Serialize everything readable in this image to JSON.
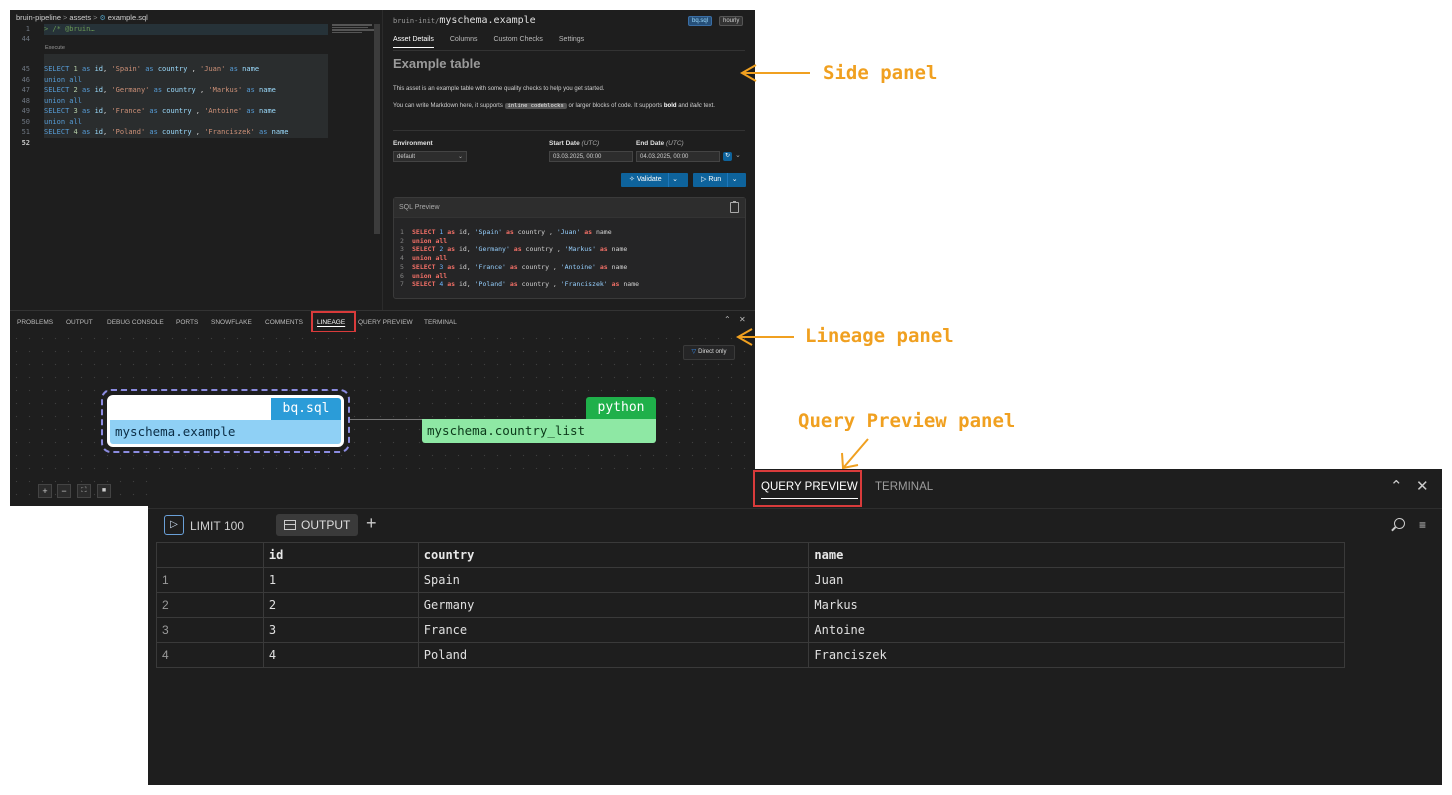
{
  "editor": {
    "breadcrumb": [
      "bruin-pipeline",
      "assets",
      "example.sql"
    ],
    "execute_label": "Execute",
    "lines": [
      {
        "n": "1",
        "tokens": [
          [
            "cm",
            "> /* @bruin…"
          ]
        ]
      },
      {
        "n": "44",
        "tokens": []
      },
      {
        "n": "45",
        "tokens": [
          [
            "kw",
            "SELECT "
          ],
          [
            "num",
            "1"
          ],
          [
            "kw",
            " as "
          ],
          [
            "id",
            "id"
          ],
          [
            "plain",
            ", "
          ],
          [
            "str",
            "'Spain'"
          ],
          [
            "kw",
            " as "
          ],
          [
            "id",
            "country"
          ],
          [
            "plain",
            " , "
          ],
          [
            "str",
            "'Juan'"
          ],
          [
            "kw",
            " as "
          ],
          [
            "id",
            "name"
          ]
        ]
      },
      {
        "n": "46",
        "tokens": [
          [
            "kw",
            "union all"
          ]
        ]
      },
      {
        "n": "47",
        "tokens": [
          [
            "kw",
            "SELECT "
          ],
          [
            "num",
            "2"
          ],
          [
            "kw",
            " as "
          ],
          [
            "id",
            "id"
          ],
          [
            "plain",
            ", "
          ],
          [
            "str",
            "'Germany'"
          ],
          [
            "kw",
            " as "
          ],
          [
            "id",
            "country"
          ],
          [
            "plain",
            " , "
          ],
          [
            "str",
            "'Markus'"
          ],
          [
            "kw",
            " as "
          ],
          [
            "id",
            "name"
          ]
        ]
      },
      {
        "n": "48",
        "tokens": [
          [
            "kw",
            "union all"
          ]
        ]
      },
      {
        "n": "49",
        "tokens": [
          [
            "kw",
            "SELECT "
          ],
          [
            "num",
            "3"
          ],
          [
            "kw",
            " as "
          ],
          [
            "id",
            "id"
          ],
          [
            "plain",
            ", "
          ],
          [
            "str",
            "'France'"
          ],
          [
            "kw",
            " as "
          ],
          [
            "id",
            "country"
          ],
          [
            "plain",
            " , "
          ],
          [
            "str",
            "'Antoine'"
          ],
          [
            "kw",
            " as "
          ],
          [
            "id",
            "name"
          ]
        ]
      },
      {
        "n": "50",
        "tokens": [
          [
            "kw",
            "union all"
          ]
        ]
      },
      {
        "n": "51",
        "tokens": [
          [
            "kw",
            "SELECT "
          ],
          [
            "num",
            "4"
          ],
          [
            "kw",
            " as "
          ],
          [
            "id",
            "id"
          ],
          [
            "plain",
            ", "
          ],
          [
            "str",
            "'Poland'"
          ],
          [
            "kw",
            " as "
          ],
          [
            "id",
            "country"
          ],
          [
            "plain",
            " , "
          ],
          [
            "str",
            "'Franciszek'"
          ],
          [
            "kw",
            " as "
          ],
          [
            "id",
            "name"
          ]
        ]
      },
      {
        "n": "52",
        "tokens": []
      }
    ]
  },
  "side_panel": {
    "path_prefix": "bruin-init/",
    "asset_name": "myschema.example",
    "type_badge": "bq.sql",
    "schedule_badge": "hourly",
    "tabs": [
      "Asset Details",
      "Columns",
      "Custom Checks",
      "Settings"
    ],
    "title": "Example table",
    "desc1": "This asset is an example table with some quality checks to help you get started.",
    "desc2_a": "You can write Markdown here, it supports ",
    "desc2_code": "inline codeblocks",
    "desc2_b": " or larger blocks of code. It supports ",
    "desc2_bold": "bold",
    "desc2_c": " and ",
    "desc2_italic": "italic",
    "desc2_d": " text.",
    "environment_label": "Environment",
    "environment_value": "default",
    "start_label": "Start Date",
    "end_label": "End Date",
    "utc": "(UTC)",
    "start_value": "03.03.2025, 00:00",
    "end_value": "04.03.2025, 00:00",
    "validate_label": "Validate",
    "run_label": "Run",
    "sql_preview_title": "SQL Preview",
    "sql_preview_lines": [
      {
        "n": "1",
        "tokens": [
          [
            "pkw",
            "SELECT "
          ],
          [
            "pnum",
            "1"
          ],
          [
            "pkw",
            " as "
          ],
          [
            "plain",
            "id, "
          ],
          [
            "pstr",
            "'Spain'"
          ],
          [
            "pkw",
            " as "
          ],
          [
            "plain",
            "country , "
          ],
          [
            "pstr",
            "'Juan'"
          ],
          [
            "pkw",
            " as "
          ],
          [
            "plain",
            "name"
          ]
        ]
      },
      {
        "n": "2",
        "tokens": [
          [
            "pkw",
            "union all"
          ]
        ]
      },
      {
        "n": "3",
        "tokens": [
          [
            "pkw",
            "SELECT "
          ],
          [
            "pnum",
            "2"
          ],
          [
            "pkw",
            " as "
          ],
          [
            "plain",
            "id, "
          ],
          [
            "pstr",
            "'Germany'"
          ],
          [
            "pkw",
            " as "
          ],
          [
            "plain",
            "country , "
          ],
          [
            "pstr",
            "'Markus'"
          ],
          [
            "pkw",
            " as "
          ],
          [
            "plain",
            "name"
          ]
        ]
      },
      {
        "n": "4",
        "tokens": [
          [
            "pkw",
            "union all"
          ]
        ]
      },
      {
        "n": "5",
        "tokens": [
          [
            "pkw",
            "SELECT "
          ],
          [
            "pnum",
            "3"
          ],
          [
            "pkw",
            " as "
          ],
          [
            "plain",
            "id, "
          ],
          [
            "pstr",
            "'France'"
          ],
          [
            "pkw",
            " as "
          ],
          [
            "plain",
            "country , "
          ],
          [
            "pstr",
            "'Antoine'"
          ],
          [
            "pkw",
            " as "
          ],
          [
            "plain",
            "name"
          ]
        ]
      },
      {
        "n": "6",
        "tokens": [
          [
            "pkw",
            "union all"
          ]
        ]
      },
      {
        "n": "7",
        "tokens": [
          [
            "pkw",
            "SELECT "
          ],
          [
            "pnum",
            "4"
          ],
          [
            "pkw",
            " as "
          ],
          [
            "plain",
            "id, "
          ],
          [
            "pstr",
            "'Poland'"
          ],
          [
            "pkw",
            " as "
          ],
          [
            "plain",
            "country , "
          ],
          [
            "pstr",
            "'Franciszek'"
          ],
          [
            "pkw",
            " as "
          ],
          [
            "plain",
            "name"
          ]
        ]
      }
    ]
  },
  "panel_tabs": [
    "PROBLEMS",
    "OUTPUT",
    "DEBUG CONSOLE",
    "PORTS",
    "SNOWFLAKE",
    "COMMENTS",
    "LINEAGE",
    "QUERY PREVIEW",
    "TERMINAL"
  ],
  "lineage": {
    "direct_only_label": "Direct only",
    "node_a": {
      "badge": "bq.sql",
      "name": "myschema.example"
    },
    "node_b": {
      "badge": "python",
      "name": "myschema.country_list"
    }
  },
  "annotations": {
    "side_panel": "Side panel",
    "lineage_panel": "Lineage panel",
    "query_preview_panel": "Query Preview panel"
  },
  "query_preview": {
    "tab_query": "QUERY PREVIEW",
    "tab_terminal": "TERMINAL",
    "limit_label": "LIMIT",
    "limit_value": "100",
    "output_label": "OUTPUT",
    "columns": [
      "",
      "id",
      "country",
      "name"
    ],
    "rows": [
      [
        "1",
        "1",
        "Spain",
        "Juan"
      ],
      [
        "2",
        "2",
        "Germany",
        "Markus"
      ],
      [
        "3",
        "3",
        "France",
        "Antoine"
      ],
      [
        "4",
        "4",
        "Poland",
        "Franciszek"
      ]
    ]
  },
  "colors": {
    "annotation": "#f0a020",
    "highlight": "#d93b3b",
    "bq_badge": "#2b9cd8",
    "python_badge": "#1fb04a",
    "accent": "#0e639c"
  },
  "icons": [
    "file-sql-icon",
    "clipboard-icon",
    "funnel-icon",
    "chevron-up-icon",
    "close-icon",
    "play-icon",
    "table-icon",
    "plus-icon",
    "search-icon",
    "filter-list-icon",
    "zoom-in-icon",
    "zoom-out-icon",
    "fit-view-icon",
    "lock-icon",
    "sync-icon"
  ]
}
